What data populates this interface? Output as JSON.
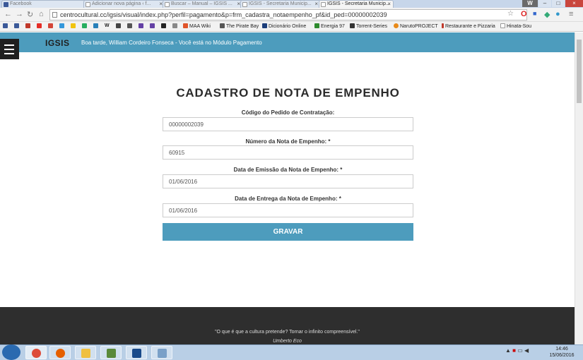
{
  "browser": {
    "tabs": [
      {
        "label": "Facebook",
        "active": false
      },
      {
        "label": "Adicionar nova página ‹ f...",
        "active": false
      },
      {
        "label": "Buscar – Manual – IGSIS ...",
        "active": false
      },
      {
        "label": "IGSIS - Secretaria Municip...",
        "active": false
      },
      {
        "label": "IGSIS - Secretaria Municip...",
        "active": true
      }
    ],
    "url": "centrocultural.cc/igsis/visual/index.php?perfil=pagamento&p=frm_cadastra_notaempenho_pf&id_ped=00000002039",
    "bookmarks": [
      {
        "label": "MAA Wiki",
        "color": "#e0542a"
      },
      {
        "label": "The Pirate Bay",
        "color": "#555555"
      },
      {
        "label": "Dicionário Online",
        "color": "#1b3d7a"
      },
      {
        "label": "Energia 97",
        "color": "#2e8b2e"
      },
      {
        "label": "Torrent-Series",
        "color": "#333333"
      },
      {
        "label": "NarutoPROJECT",
        "color": "#e88a1a"
      },
      {
        "label": "Restaurante e Pizzaria",
        "color": "#c0392b"
      },
      {
        "label": "Hinata-Sou",
        "color": "#888888"
      }
    ]
  },
  "app": {
    "logo": "IGSIS",
    "greeting": "Boa tarde, William Cordeiro Fonseca - Você está no Módulo Pagamento"
  },
  "form": {
    "title": "CADASTRO DE NOTA DE EMPENHO",
    "fields": [
      {
        "label": "Código do Pedido de Contratação:",
        "value": "00000002039"
      },
      {
        "label": "Número da Nota de Empenho: *",
        "value": "60915"
      },
      {
        "label": "Data de Emissão da Nota de Empenho: *",
        "value": "01/06/2016"
      },
      {
        "label": "Data de Entrega da Nota de Empenho: *",
        "value": "01/06/2016"
      }
    ],
    "submit_label": "GRAVAR"
  },
  "footer": {
    "quote": "\"O que é que a cultura pretende? Tornar o infinito compreensível.\"",
    "author": "Umberto Eco"
  },
  "taskbar": {
    "time": "14:46",
    "date": "15/06/2016"
  },
  "colors": {
    "accent": "#4d9cbd",
    "footer_bg": "#2e2e2e",
    "menu_bg": "#1f1f1f"
  }
}
